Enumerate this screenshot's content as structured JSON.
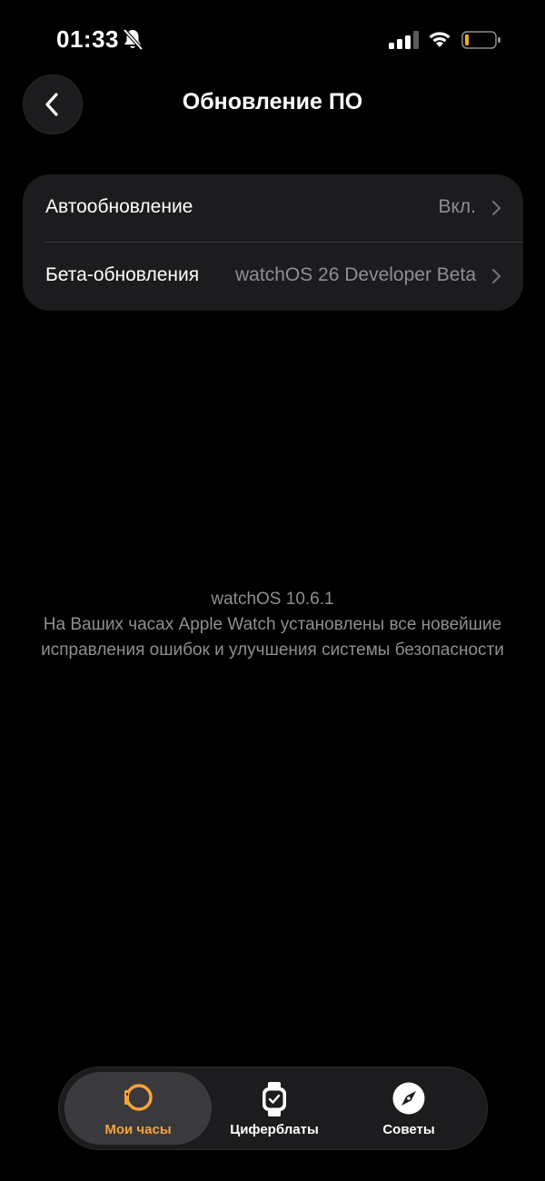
{
  "status_bar": {
    "time": "01:33",
    "icons": [
      "bell-slash-icon",
      "cellular-signal-icon",
      "wifi-icon",
      "battery-low-icon"
    ]
  },
  "nav": {
    "back_icon": "chevron-left-icon",
    "title": "Обновление ПО"
  },
  "settings": {
    "rows": [
      {
        "label": "Автообновление",
        "value": "Вкл.",
        "icon": "chevron-right-icon"
      },
      {
        "label": "Бета-обновления",
        "value": "watchOS 26 Developer Beta",
        "icon": "chevron-right-icon"
      }
    ]
  },
  "info": {
    "version": "watchOS 10.6.1",
    "description": "На Ваших часах Apple Watch установлены все новейшие исправления ошибок и улучшения системы безопасности"
  },
  "tab_bar": {
    "tabs": [
      {
        "label": "Мои часы",
        "icon": "watch-icon",
        "selected": true
      },
      {
        "label": "Циферблаты",
        "icon": "watch-face-icon",
        "selected": false
      },
      {
        "label": "Советы",
        "icon": "compass-icon",
        "selected": false
      }
    ]
  },
  "colors": {
    "background": "#000000",
    "card": "#1c1c1e",
    "secondary_text": "#8e8e93",
    "accent": "#f7a23b",
    "battery_low": "#f5a623"
  }
}
